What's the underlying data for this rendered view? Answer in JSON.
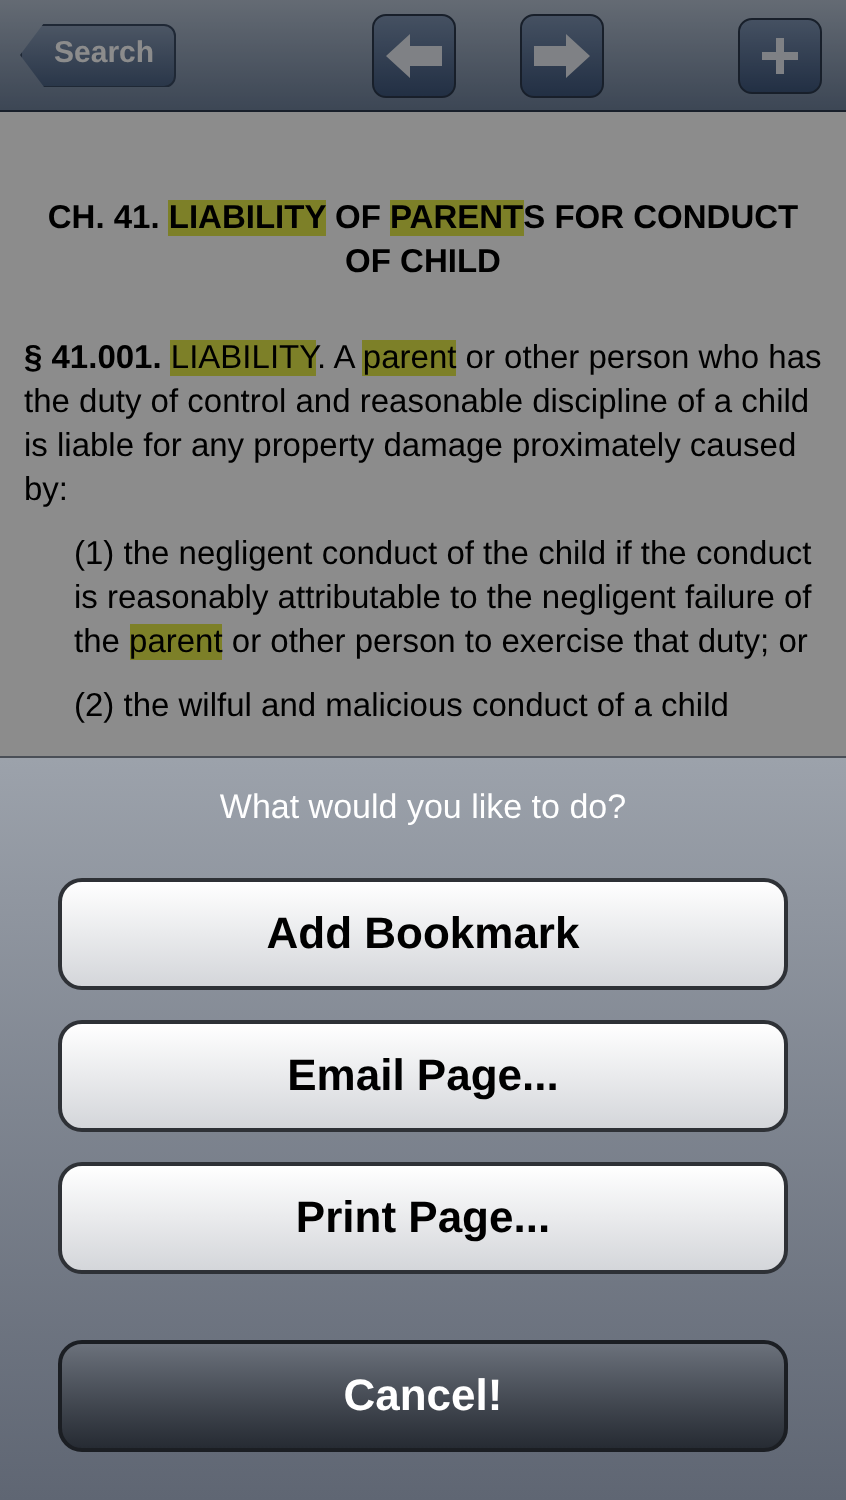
{
  "nav_bar": {
    "back_button": "Search"
  },
  "document": {
    "heading": [
      {
        "text": "CH. 41. "
      },
      {
        "text": "LIABILITY",
        "highlight": true
      },
      {
        "text": " OF "
      },
      {
        "text": "PARENT",
        "highlight": true
      },
      {
        "text": "S FOR CONDUCT OF CHILD"
      }
    ],
    "paragraphs": [
      {
        "indent": false,
        "segments": [
          {
            "text": "§ 41.001. ",
            "bold": true
          },
          {
            "text": "LIABILITY",
            "highlight": true
          },
          {
            "text": ". A "
          },
          {
            "text": "parent",
            "highlight": true
          },
          {
            "text": " or other person who has the duty of control and reasonable discipline of a child is liable for any property damage proximately caused by:"
          }
        ]
      },
      {
        "indent": true,
        "segments": [
          {
            "text": "(1) the negligent conduct of the child if the conduct is reasonably attributable to the negligent failure of the "
          },
          {
            "text": "parent",
            "highlight": true
          },
          {
            "text": " or other person to exercise that duty; or"
          }
        ]
      },
      {
        "indent": true,
        "segments": [
          {
            "text": "(2) the wilful and malicious conduct of a child"
          }
        ]
      }
    ]
  },
  "action_sheet": {
    "title": "What would you like to do?",
    "buttons": [
      {
        "label": "Add Bookmark",
        "kind": "default"
      },
      {
        "label": "Email Page...",
        "kind": "default"
      },
      {
        "label": "Print Page...",
        "kind": "default"
      },
      {
        "label": "Cancel!",
        "kind": "cancel"
      }
    ]
  }
}
